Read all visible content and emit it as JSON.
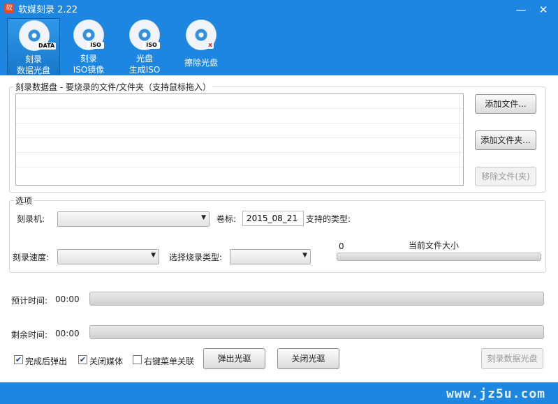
{
  "window": {
    "title": "软媒刻录 2.22",
    "app_icon": "软",
    "minimize_glyph": "—",
    "close_glyph": "✕",
    "accent_color": "#1c86e0"
  },
  "toolbar": [
    {
      "icon": "disc-data-icon",
      "badge": "DATA",
      "line1": "刻录",
      "line2": "数据光盘",
      "active": true
    },
    {
      "icon": "disc-iso-burn-icon",
      "badge": "ISO",
      "line1": "刻录",
      "line2": "ISO镜像",
      "active": false
    },
    {
      "icon": "disc-iso-create-icon",
      "badge": "ISO",
      "line1": "光盘",
      "line2": "生成ISO",
      "active": false
    },
    {
      "icon": "disc-erase-icon",
      "badge": "x",
      "line1": "擦除光盘",
      "line2": "",
      "active": false
    }
  ],
  "files_group": {
    "legend": "刻录数据盘 - 要烧录的文件/文件夹（支持鼠标拖入）",
    "add_file": "添加文件...",
    "add_folder": "添加文件夹...",
    "remove": "移除文件(夹)"
  },
  "options": {
    "legend": "选项",
    "burner_label": "刻录机:",
    "burner_value": "",
    "volume_label": "卷标:",
    "volume_value": "2015_08_21",
    "supported_types_label": "支持的类型:",
    "speed_label": "刻录速度:",
    "speed_value": "",
    "burn_type_label": "选择烧录类型:",
    "burn_type_value": "",
    "size_value": "0",
    "current_size_label": "当前文件大小",
    "size_progress": 0
  },
  "progress": {
    "estimated_label": "预计时间:",
    "estimated_value": "00:00",
    "estimated_fraction": 0,
    "remaining_label": "剩余时间:",
    "remaining_value": "00:00",
    "remaining_fraction": 0
  },
  "bottom": {
    "eject_after": {
      "label": "完成后弹出",
      "checked": true
    },
    "close_media": {
      "label": "关闭媒体",
      "checked": true
    },
    "context_menu": {
      "label": "右键菜单关联",
      "checked": false
    },
    "eject_button": "弹出光驱",
    "close_tray_button": "关闭光驱",
    "burn_button": "刻录数据光盘"
  },
  "statusbar": {
    "watermark": "www.jz5u.com"
  }
}
